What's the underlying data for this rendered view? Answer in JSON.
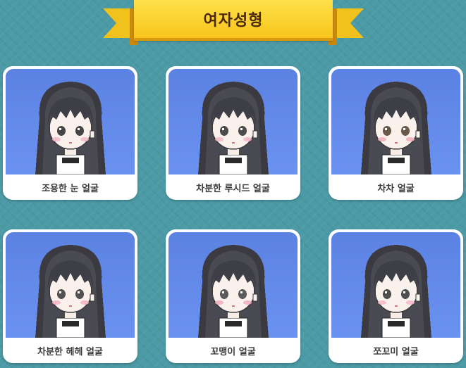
{
  "header": {
    "title": "여자성형"
  },
  "faces": [
    {
      "label": "조용한 눈 얼굴",
      "eye_color": "#454545",
      "blush": "#f5b8c6"
    },
    {
      "label": "차분한 루시드 얼굴",
      "eye_color": "#4c4c4c",
      "blush": "#f2b5c3"
    },
    {
      "label": "차차 얼굴",
      "eye_color": "#6b5a4a",
      "blush": "#f0aab8"
    },
    {
      "label": "차분한 헤헤 얼굴",
      "eye_color": "#525252",
      "blush": "#f5b0c0"
    },
    {
      "label": "꼬맹이 얼굴",
      "eye_color": "#5a5a5a",
      "blush": "#f2a8b6"
    },
    {
      "label": "쪼꼬미 얼굴",
      "eye_color": "#4e4e4e",
      "blush": "#f8b4c4"
    }
  ]
}
